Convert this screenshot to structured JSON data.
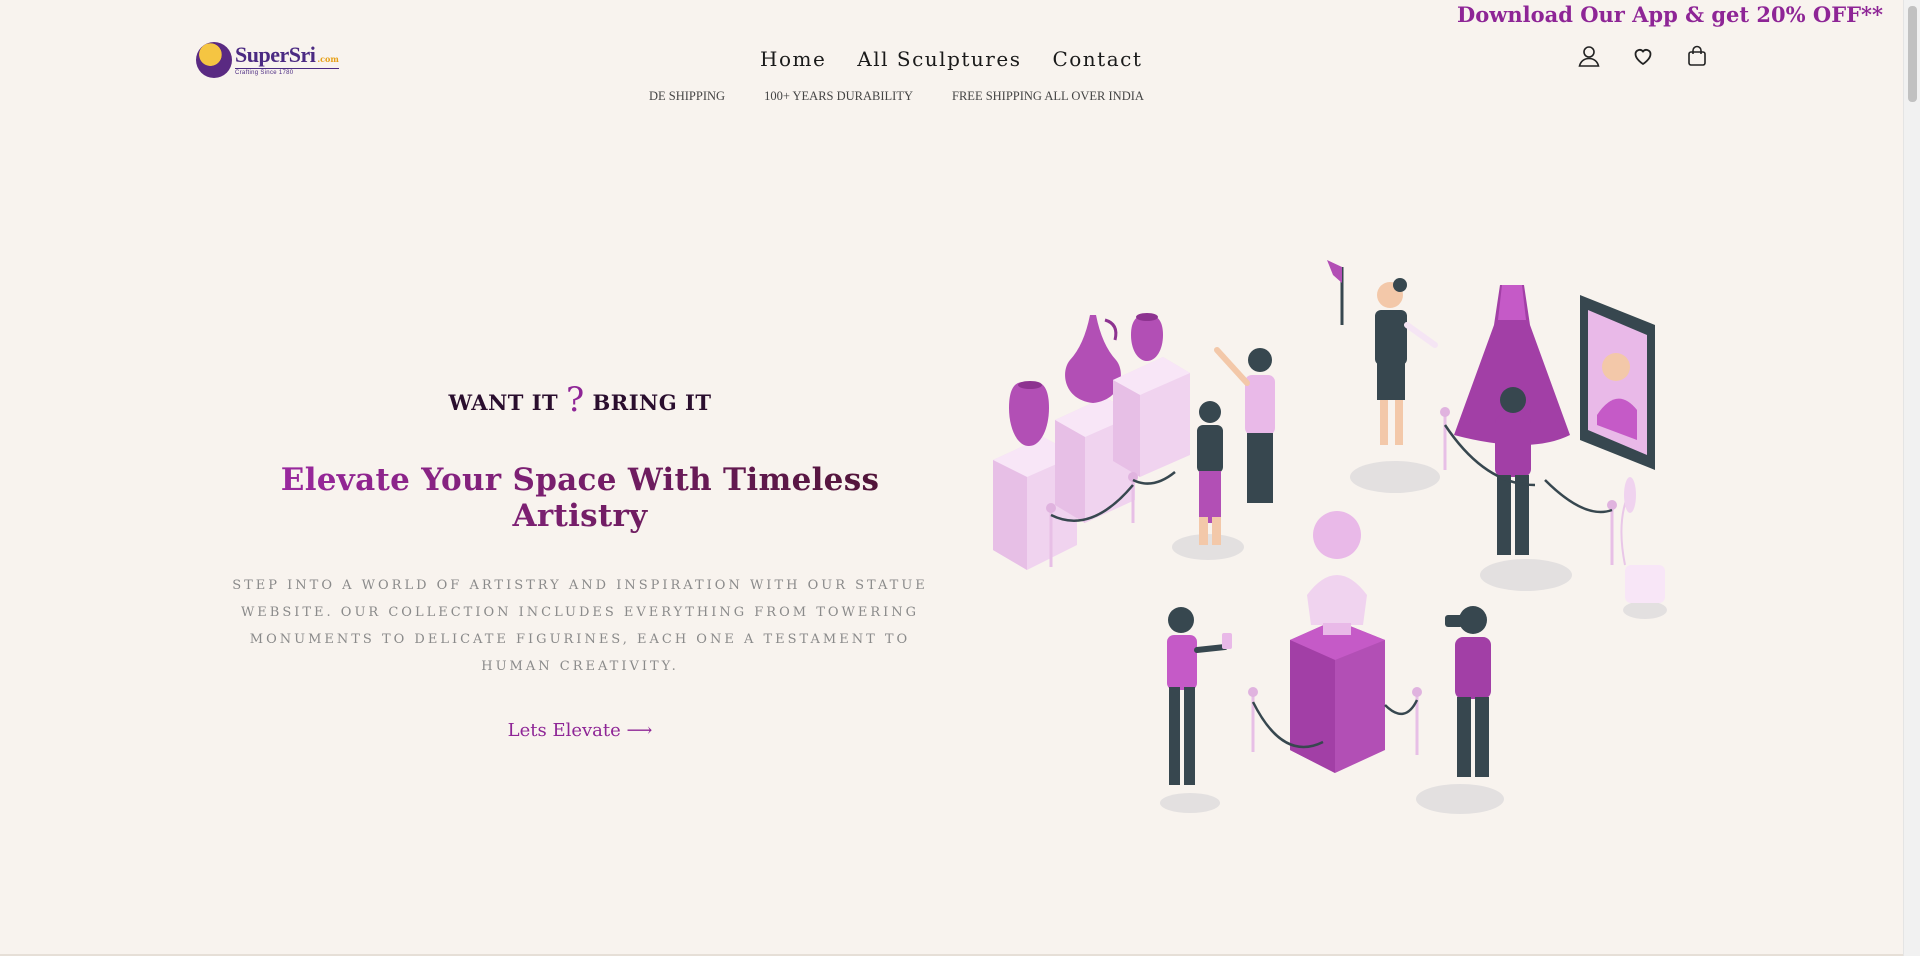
{
  "promo": {
    "text": "Download Our App & get 20% OFF**"
  },
  "logo": {
    "name": "SuperSri",
    "domain": ".com",
    "tagline": "Crafting Since 1780"
  },
  "nav": {
    "items": [
      {
        "label": "Home"
      },
      {
        "label": "All Sculptures"
      },
      {
        "label": "Contact"
      }
    ]
  },
  "marquee": {
    "items": [
      "DE SHIPPING",
      "100+ YEARS DURABILITY",
      "FREE SHIPPING ALL OVER INDIA"
    ]
  },
  "header_icons": [
    "account-icon",
    "wishlist-heart-icon",
    "cart-bag-icon"
  ],
  "hero": {
    "tagline_left": "WANT IT",
    "tagline_mark": "?",
    "tagline_right": "BRING IT",
    "headline": "Elevate Your Space With Timeless Artistry",
    "description": "Step into a world of artistry and inspiration with our statue website. Our collection includes everything from towering monuments to delicate figurines, each one a testament to human creativity.",
    "cta": "Lets Elevate ⟶"
  },
  "colors": {
    "background": "#f8f3ee",
    "accent": "#8e2596",
    "illustration_pink": "#c55ac7",
    "illustration_dark": "#37474f"
  }
}
